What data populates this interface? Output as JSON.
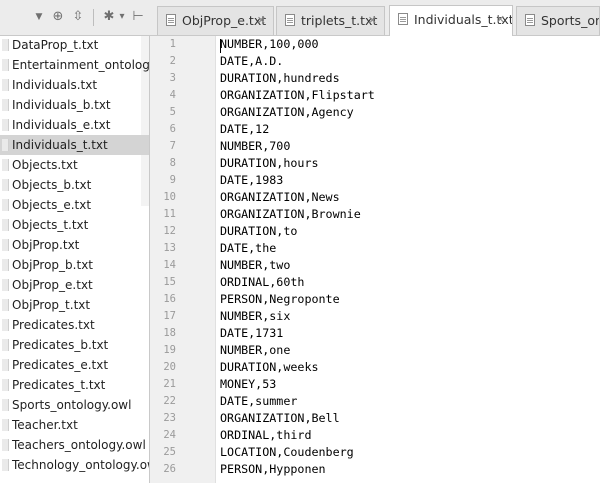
{
  "toolbar": {
    "icons": [
      "dropdown-arrow-icon",
      "target-icon",
      "collapse-all-icon",
      "gear-icon",
      "hide-panel-icon"
    ],
    "glyphs": {
      "dropdown": "▼",
      "target": "⊕",
      "collapse": "⇳",
      "gear": "✱",
      "settings_arrow": "▾",
      "hide": "⊢"
    }
  },
  "tabs": [
    {
      "label": "ObjProp_e.txt",
      "close": "✕",
      "active": false
    },
    {
      "label": "triplets_t.txt",
      "close": "✕",
      "active": false
    },
    {
      "label": "Individuals_t.txt",
      "close": "✕",
      "active": true
    },
    {
      "label": "Sports_ontology.owl",
      "close": "",
      "active": false
    }
  ],
  "sidebar": {
    "files": [
      "DataProp_t.txt",
      "Entertainment_ontology.owl",
      "Individuals.txt",
      "Individuals_b.txt",
      "Individuals_e.txt",
      "Individuals_t.txt",
      "Objects.txt",
      "Objects_b.txt",
      "Objects_e.txt",
      "Objects_t.txt",
      "ObjProp.txt",
      "ObjProp_b.txt",
      "ObjProp_e.txt",
      "ObjProp_t.txt",
      "Predicates.txt",
      "Predicates_b.txt",
      "Predicates_e.txt",
      "Predicates_t.txt",
      "Sports_ontology.owl",
      "Teacher.txt",
      "Teachers_ontology.owl",
      "Technology_ontology.owl"
    ],
    "selected": "Individuals_t.txt"
  },
  "editor": {
    "lines": [
      {
        "n": "1",
        "text": "NUMBER,100,000"
      },
      {
        "n": "2",
        "text": "DATE,A.D."
      },
      {
        "n": "3",
        "text": "DURATION,hundreds"
      },
      {
        "n": "4",
        "text": "ORGANIZATION,Flipstart"
      },
      {
        "n": "5",
        "text": "ORGANIZATION,Agency"
      },
      {
        "n": "6",
        "text": "DATE,12"
      },
      {
        "n": "7",
        "text": "NUMBER,700"
      },
      {
        "n": "8",
        "text": "DURATION,hours"
      },
      {
        "n": "9",
        "text": "DATE,1983"
      },
      {
        "n": "10",
        "text": "ORGANIZATION,News"
      },
      {
        "n": "11",
        "text": "ORGANIZATION,Brownie"
      },
      {
        "n": "12",
        "text": "DURATION,to"
      },
      {
        "n": "13",
        "text": "DATE,the"
      },
      {
        "n": "14",
        "text": "NUMBER,two"
      },
      {
        "n": "15",
        "text": "ORDINAL,60th"
      },
      {
        "n": "16",
        "text": "PERSON,Negroponte"
      },
      {
        "n": "17",
        "text": "NUMBER,six"
      },
      {
        "n": "18",
        "text": "DATE,1731"
      },
      {
        "n": "19",
        "text": "NUMBER,one"
      },
      {
        "n": "20",
        "text": "DURATION,weeks"
      },
      {
        "n": "21",
        "text": "MONEY,53"
      },
      {
        "n": "22",
        "text": "DATE,summer"
      },
      {
        "n": "23",
        "text": "ORGANIZATION,Bell"
      },
      {
        "n": "24",
        "text": "ORDINAL,third"
      },
      {
        "n": "25",
        "text": "LOCATION,Coudenberg"
      },
      {
        "n": "26",
        "text": "PERSON,Hypponen"
      }
    ]
  }
}
